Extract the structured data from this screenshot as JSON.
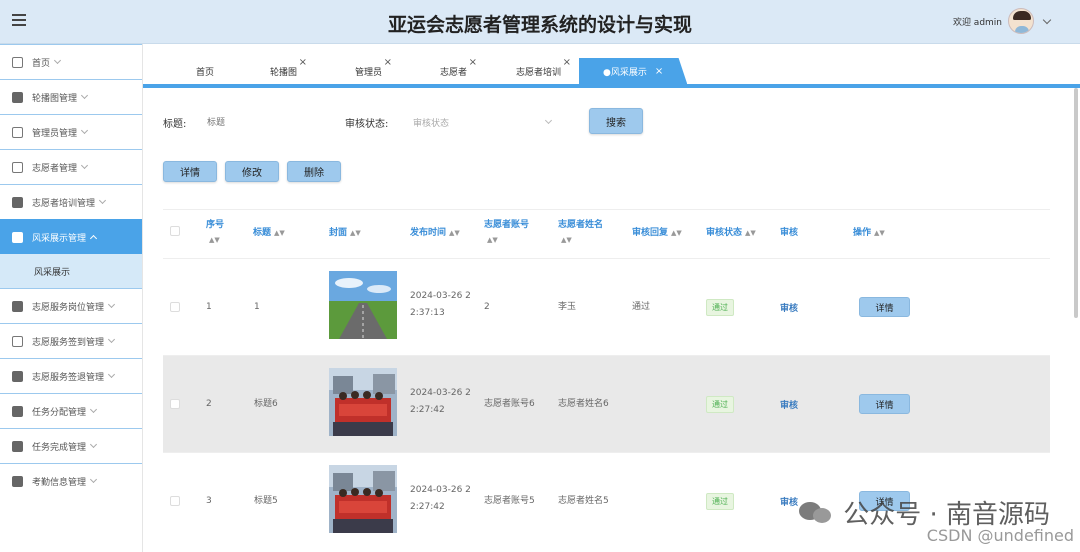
{
  "header": {
    "title": "亚运会志愿者管理系统的设计与实现",
    "welcome": "欢迎 admin"
  },
  "sidebar": {
    "items": [
      {
        "label": "首页"
      },
      {
        "label": "轮播图管理"
      },
      {
        "label": "管理员管理"
      },
      {
        "label": "志愿者管理"
      },
      {
        "label": "志愿者培训管理"
      },
      {
        "label": "风采展示管理"
      },
      {
        "label": "志愿服务岗位管理"
      },
      {
        "label": "志愿服务签到管理"
      },
      {
        "label": "志愿服务签退管理"
      },
      {
        "label": "任务分配管理"
      },
      {
        "label": "任务完成管理"
      },
      {
        "label": "考勤信息管理"
      }
    ],
    "sub_item": "风采展示"
  },
  "tabs": [
    {
      "label": "首页"
    },
    {
      "label": "轮播图"
    },
    {
      "label": "管理员"
    },
    {
      "label": "志愿者"
    },
    {
      "label": "志愿者培训"
    },
    {
      "label": "●风采展示"
    }
  ],
  "tab_close": "×",
  "search": {
    "title_label": "标题:",
    "title_placeholder": "标题",
    "status_label": "审核状态:",
    "status_placeholder": "审核状态",
    "search_button": "搜索"
  },
  "actions": {
    "detail": "详情",
    "edit": "修改",
    "delete": "删除"
  },
  "table": {
    "headers": {
      "index": "序号",
      "title": "标题",
      "cover": "封面",
      "publish_time": "发布时间",
      "account": "志愿者账号",
      "name": "志愿者姓名",
      "reply": "审核回复",
      "status": "审核状态",
      "audit": "审核",
      "operation": "操作"
    },
    "rows": [
      {
        "index": "1",
        "title": "1",
        "time1": "2024-03-26 2",
        "time2": "2:37:13",
        "account": "2",
        "name": "李玉",
        "reply": "通过",
        "status": "通过",
        "audit": "审核",
        "detail": "详情"
      },
      {
        "index": "2",
        "title": "标题6",
        "time1": "2024-03-26 2",
        "time2": "2:27:42",
        "account": "志愿者账号6",
        "name": "志愿者姓名6",
        "reply": "",
        "status": "通过",
        "audit": "审核",
        "detail": "详情"
      },
      {
        "index": "3",
        "title": "标题5",
        "time1": "2024-03-26 2",
        "time2": "2:27:42",
        "account": "志愿者账号5",
        "name": "志愿者姓名5",
        "reply": "",
        "status": "通过",
        "audit": "审核",
        "detail": "详情"
      }
    ]
  },
  "watermark": {
    "line1": "公众号 · 南音源码",
    "line2": "CSDN @undefined"
  }
}
